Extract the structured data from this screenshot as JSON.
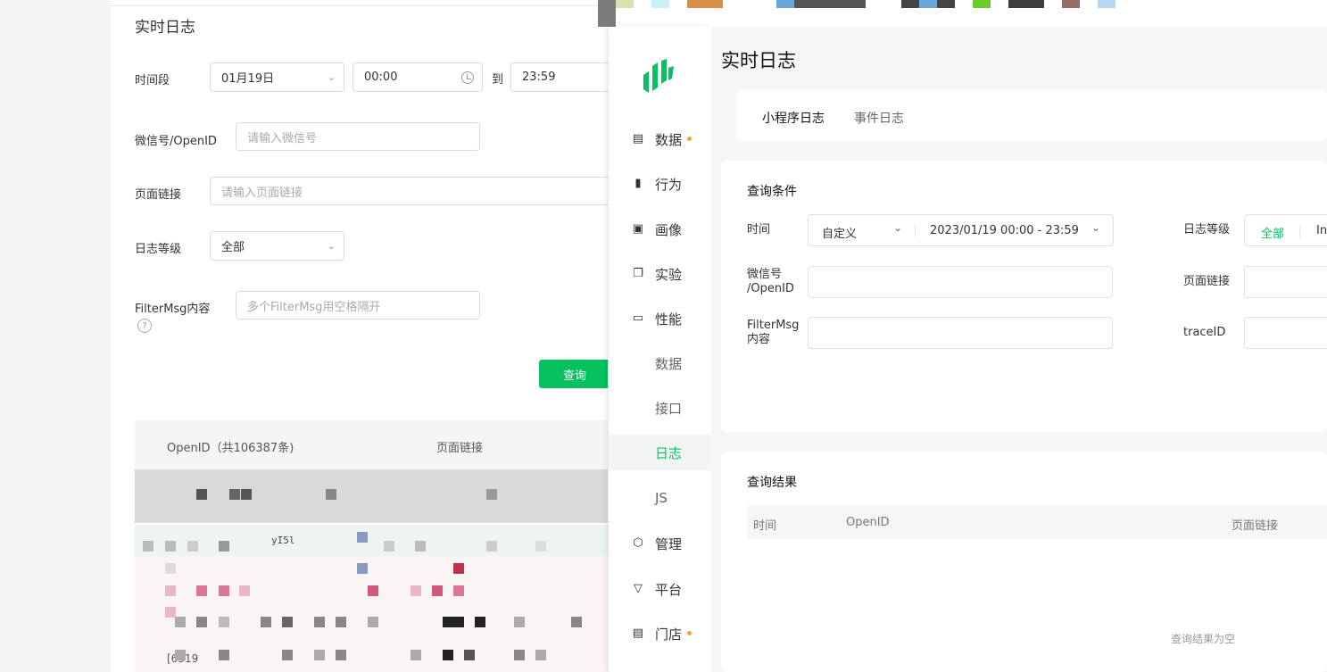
{
  "old_window": {
    "title": "实时日志",
    "time_label": "时间段",
    "date_value": "01月19日",
    "start_time": "00:00",
    "to_label": "到",
    "end_time": "23:59",
    "wechat_label": "微信号/OpenID",
    "wechat_placeholder": "请输入微信号",
    "page_link_label": "页面链接",
    "page_link_placeholder": "请输入页面链接",
    "log_level_label": "日志等级",
    "log_level_value": "全部",
    "filtermsg_label": "FilterMsg内容",
    "filtermsg_placeholder": "多个FilterMsg用空格隔开",
    "help_glyph": "?",
    "query_button": "查询",
    "table": {
      "openid_header": "OpenID（共106387条)",
      "page_link_header": "页面链接"
    },
    "visible_fragments": [
      "yI5l"
    ],
    "cell_fragment": "[6319"
  },
  "nav": {
    "items": [
      {
        "label": "数据",
        "icon": "calendar-chart-icon",
        "dot": true
      },
      {
        "label": "行为",
        "icon": "bar-chart-icon",
        "dot": false
      },
      {
        "label": "画像",
        "icon": "portrait-icon",
        "dot": false
      },
      {
        "label": "实验",
        "icon": "copy-squares-icon",
        "dot": false
      },
      {
        "label": "性能",
        "icon": "monitor-icon",
        "dot": false
      }
    ],
    "sub_items": [
      {
        "label": "数据",
        "active": false
      },
      {
        "label": "接口",
        "active": false
      },
      {
        "label": "日志",
        "active": true
      },
      {
        "label": "JS",
        "active": false
      }
    ],
    "bottom_items": [
      {
        "label": "管理",
        "icon": "hexagon-check-icon",
        "dot": false
      },
      {
        "label": "平台",
        "icon": "platform-icon",
        "dot": false
      },
      {
        "label": "门店",
        "icon": "store-icon",
        "dot": true
      }
    ],
    "accent_color": "#07c160",
    "dot_color": "#fa9d3b"
  },
  "main": {
    "title": "实时日志",
    "tabs": [
      {
        "label": "小程序日志",
        "active": true
      },
      {
        "label": "事件日志",
        "active": false
      }
    ],
    "conditions": {
      "title": "查询条件",
      "time_label": "时间",
      "time_mode": "自定义",
      "time_range": "2023/01/19 00:00 - 23:59",
      "log_level_label": "日志等级",
      "log_level_options": [
        "全部",
        "In"
      ],
      "log_level_selected": "全部",
      "wechat_label_line1": "微信号",
      "wechat_label_line2": "/OpenID",
      "page_link_label": "页面链接",
      "filtermsg_label_line1": "FilterMsg",
      "filtermsg_label_line2": "内容",
      "traceid_label": "traceID"
    },
    "results": {
      "title": "查询结果",
      "columns": [
        "时间",
        "OpenID",
        "页面链接"
      ],
      "empty_text": "查询结果为空"
    }
  }
}
